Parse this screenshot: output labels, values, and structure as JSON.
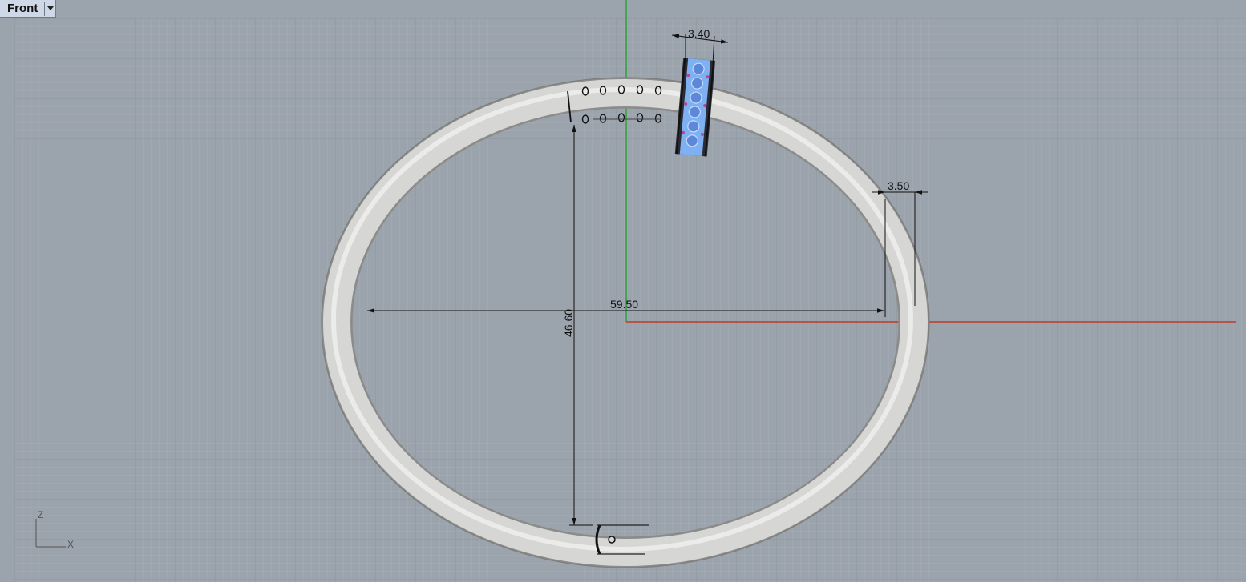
{
  "viewport": {
    "name": "Front",
    "background": "#9ba3ac",
    "grid_minor_color": "#a6adb5",
    "grid_major_color": "#8c939b",
    "x_axis_color": "#c0392b",
    "z_axis_color": "#27a33a"
  },
  "dimensions": {
    "width": "59.50",
    "height": "46.60",
    "tube_thickness": "3.50",
    "setting_width": "3.40"
  },
  "axis_widget": {
    "vertical_label": "Z",
    "horizontal_label": "X"
  },
  "colors": {
    "bangle_fill": "#d8d8d6",
    "bangle_edge": "#8d8d8b",
    "dimension_line": "#111111",
    "gem_fill": "#7fb0f2"
  }
}
